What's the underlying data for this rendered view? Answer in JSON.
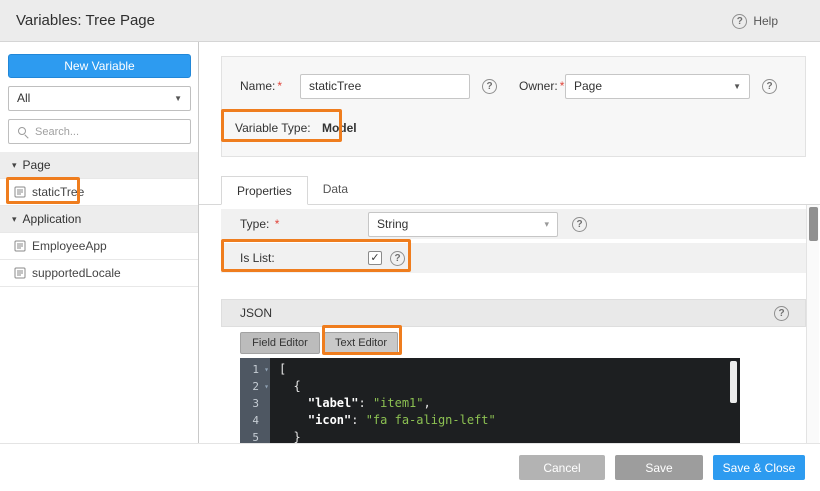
{
  "colors": {
    "accent_blue": "#2d9bf0",
    "annotation_orange": "#ef7d1e",
    "code_string_green": "#8cc152"
  },
  "icons": {
    "help": "?",
    "caret_down": "▼",
    "chevron_down": "▾",
    "group_expanded": "▾",
    "fold_caret": "▾",
    "check": "✓"
  },
  "header": {
    "title": "Variables: Tree Page",
    "help_label": "Help"
  },
  "sidebar": {
    "new_variable_label": "New Variable",
    "filter_value": "All",
    "search_placeholder": "Search...",
    "tree": [
      {
        "label": "Page",
        "type": "group"
      },
      {
        "label": "staticTree",
        "type": "item",
        "selected": true,
        "annotated": true
      },
      {
        "label": "Application",
        "type": "group"
      },
      {
        "label": "EmployeeApp",
        "type": "item"
      },
      {
        "label": "supportedLocale",
        "type": "item"
      }
    ]
  },
  "form": {
    "required_mark": "*",
    "name_label": "Name:",
    "name_value": "staticTree",
    "owner_label": "Owner:",
    "owner_value": "Page",
    "variable_type_label": "Variable Type:",
    "variable_type_value": "Model"
  },
  "tabs": {
    "properties": "Properties",
    "data": "Data"
  },
  "properties": {
    "type_label": "Type:",
    "type_value": "String",
    "is_list_label": "Is List:",
    "is_list_checked": true
  },
  "json_section": {
    "title": "JSON",
    "field_editor_label": "Field Editor",
    "text_editor_label": "Text Editor"
  },
  "code": {
    "line_numbers": [
      "1",
      "2",
      "3",
      "4",
      "5"
    ],
    "l1": "[",
    "l2": "  {",
    "l3_key": "    \"label\"",
    "l3_colon": ": ",
    "l3_str": "\"item1\"",
    "l3_comma": ",",
    "l4_key": "    \"icon\"",
    "l4_colon": ": ",
    "l4_str": "\"fa fa-align-left\"",
    "l5": "  }"
  },
  "footer": {
    "cancel_label": "Cancel",
    "save_label": "Save",
    "save_close_label": "Save & Close"
  }
}
